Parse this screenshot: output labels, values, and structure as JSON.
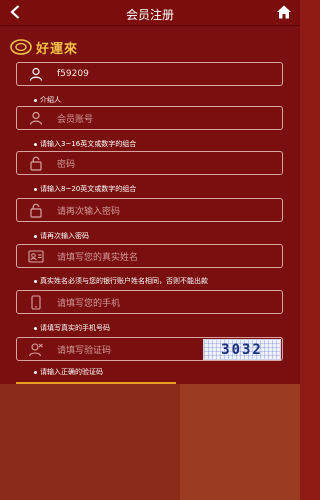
{
  "header": {
    "title": "会员注册",
    "back_icon": "chevron-left-icon",
    "home_icon": "home-icon"
  },
  "logo": {
    "text": "好運來"
  },
  "fields": {
    "referrer": {
      "value": "f59209",
      "hint": "介绍人",
      "icon": "user-icon"
    },
    "account": {
      "placeholder": "会员账号",
      "hint": "请输入3~16英文或数字的组合",
      "icon": "user-icon"
    },
    "password": {
      "placeholder": "密码",
      "hint": "请输入8~20英文或数字的组合",
      "icon": "lock-icon"
    },
    "confirm": {
      "placeholder": "请再次输入密码",
      "hint": "请再次输入密码",
      "icon": "lock-icon"
    },
    "realname": {
      "placeholder": "请填写您的真实姓名",
      "hint": "真实姓名必须与您的银行账户姓名相同，否则不能出款",
      "icon": "id-card-icon"
    },
    "phone": {
      "placeholder": "请填写您的手机",
      "hint": "请填写真实的手机号码",
      "icon": "phone-icon"
    },
    "captcha": {
      "placeholder": "请填写验证码",
      "hint": "请输入正确的验证码",
      "icon": "captcha-icon",
      "code": "3032"
    }
  },
  "colors": {
    "background": "#7a0f0f",
    "border": "#d9a3a0",
    "accent": "#e9a02a"
  }
}
